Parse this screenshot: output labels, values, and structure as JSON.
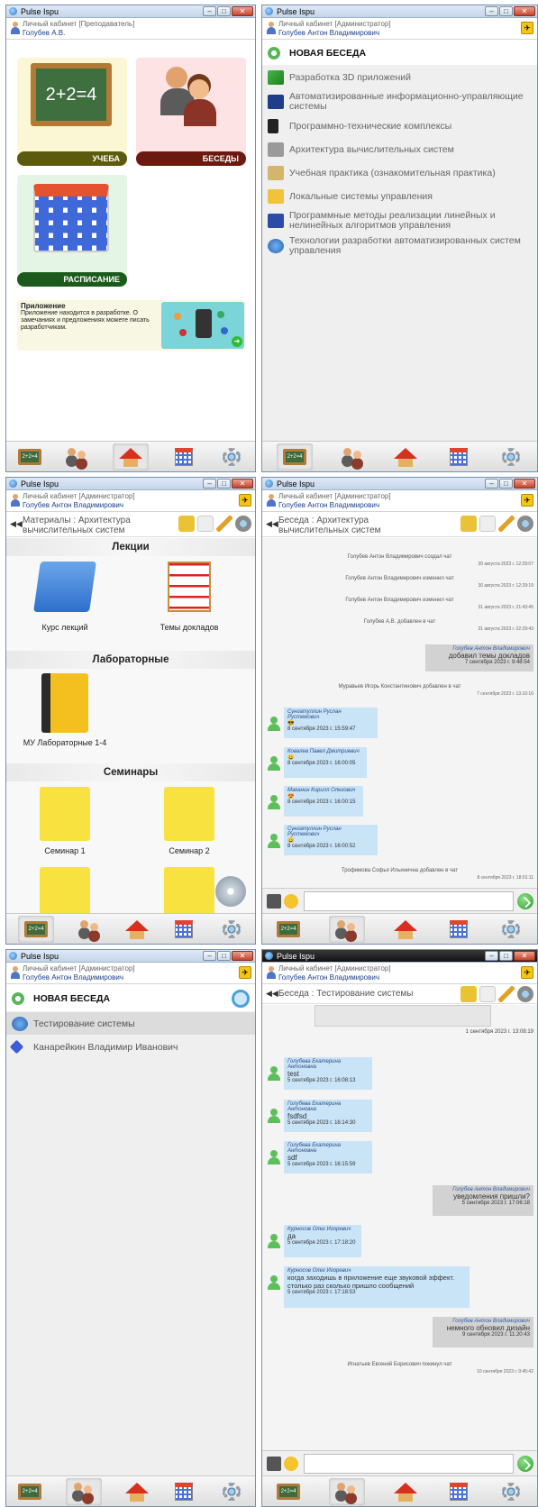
{
  "app_title": "Pulse Ispu",
  "role_teacher": "Личный кабинет [Преподаватель]",
  "role_admin": "Личный кабинет [Администратор]",
  "user_short": "Голубев А.В.",
  "user_full": "Голубев Антон Владимирович",
  "exit_symbol": "✈",
  "home": {
    "tiles": [
      {
        "label": "УЧЕБА",
        "color": "#5c5a0c"
      },
      {
        "label": "БЕСЕДЫ",
        "color": "#6b1a0f"
      },
      {
        "label": "РАСПИСАНИЕ",
        "color": "#1c5a1c"
      }
    ],
    "board_text": "2+2=4",
    "notice_title": "Приложение",
    "notice_text": "Приложение находится в разработке. О замечаниях и предложениях можете писать разработчикам."
  },
  "nav_icons": [
    "blackboard-icon",
    "people-icon",
    "house-icon",
    "calendar-icon",
    "gear-icon"
  ],
  "courses": {
    "new_chat": "НОВАЯ БЕСЕДА",
    "items": [
      "Разработка 3D приложений",
      "Автоматизированные информационно-управляющие системы",
      "Программно-технические комплексы",
      "Архитектура вычислительных систем",
      "Учебная практика (ознакомительная практика)",
      "Локальные системы управления",
      "Программные методы реализации линейных и нелинейных алгоритмов управления",
      "Технологии разработки автоматизированных систем управления"
    ]
  },
  "materials": {
    "title": "Материалы : Архитектура вычислительных систем",
    "sections": [
      "Лекции",
      "Лабораторные",
      "Семинары"
    ],
    "lectures": [
      "Курс лекций",
      "Темы докладов"
    ],
    "labs": [
      "МУ Лабораторные 1-4"
    ],
    "seminars": [
      "Семинар 1",
      "Семинар 2"
    ]
  },
  "chat1": {
    "title": "Беседа : Архитектура вычислительных систем",
    "system": [
      {
        "text": "Голубев Антон Владимирович создал чат",
        "date": "30 августа 2023 г. 12:29:07"
      },
      {
        "text": "Голубев Антон Владимирович изменил чат",
        "date": "30 августа 2023 г. 12:29:19"
      },
      {
        "text": "Голубев Антон Владимирович изменил чат",
        "date": "31 августа 2023 г. 21:43:45"
      },
      {
        "text": "Голубев А.В. добавлен в чат",
        "date": "31 августа 2023 г. 22:29:43"
      }
    ],
    "mine": {
      "author": "Голубев Антон Владимирович",
      "text": "добавил темы докладов",
      "date": "7 сентября 2023 г. 9:48:54"
    },
    "sys2": {
      "text": "Муравьев Игорь Константинович добавлен в чат",
      "date": "7 сентября 2023 г. 13:10:16"
    },
    "messages": [
      {
        "author": "Сунгатуллин Руслан Рустемович",
        "text": "😎",
        "date": "8 сентября 2023 г. 15:59:47"
      },
      {
        "author": "Ковалев Павел Дмитриевич",
        "text": "😀",
        "date": "8 сентября 2023 г. 16:00:05"
      },
      {
        "author": "Маканин Кирилл Олегович",
        "text": "😍",
        "date": "8 сентября 2023 г. 16:00:15"
      },
      {
        "author": "Сунгатуллин Руслан Рустемович",
        "text": "😄",
        "date": "8 сентября 2023 г. 16:00:52"
      }
    ],
    "sys3": {
      "text": "Трофимова Софья Ильинична добавлен в чат",
      "date": "8 сентября 2023 г. 18:01:11"
    }
  },
  "chats": {
    "new_chat": "НОВАЯ БЕСЕДА",
    "items": [
      "Тестирование системы",
      "Канарейкин Владимир Иванович"
    ]
  },
  "chat2": {
    "title": "Беседа : Тестирование системы",
    "img_date": "1 сентября 2023 г. 13:08:19",
    "messages": [
      {
        "author": "Голубева Екатерина Антоновна",
        "text": "test",
        "date": "5 сентября 2023 г. 16:08:13"
      },
      {
        "author": "Голубева Екатерина Антоновна",
        "text": "fsdfsd",
        "date": "5 сентября 2023 г. 16:14:30"
      },
      {
        "author": "Голубева Екатерина Антоновна",
        "text": "sdf",
        "date": "5 сентября 2023 г. 16:15:59"
      }
    ],
    "mine1": {
      "author": "Голубев Антон Владимирович",
      "text": "уведомления пришли?",
      "date": "5 сентября 2023 г. 17:06:18"
    },
    "messages2": [
      {
        "author": "Курносов Олег Игоревич",
        "text": "да",
        "date": "5 сентября 2023 г. 17:18:20"
      },
      {
        "author": "Курносов Олег Игоревич",
        "text": "когда заходишь в приложение еще звуковой эффект. столько раз сколько пришло сообщений",
        "date": "5 сентября 2023 г. 17:18:53"
      }
    ],
    "mine2": {
      "author": "Голубев Антон Владимирович",
      "text": "немного обновил дизайн",
      "date": "9 сентября 2023 г. 11:20:43"
    },
    "sys": {
      "text": "Игнатьев Евгений Борисович покинул чат",
      "date": "10 сентября 2023 г. 9:45:42"
    }
  }
}
